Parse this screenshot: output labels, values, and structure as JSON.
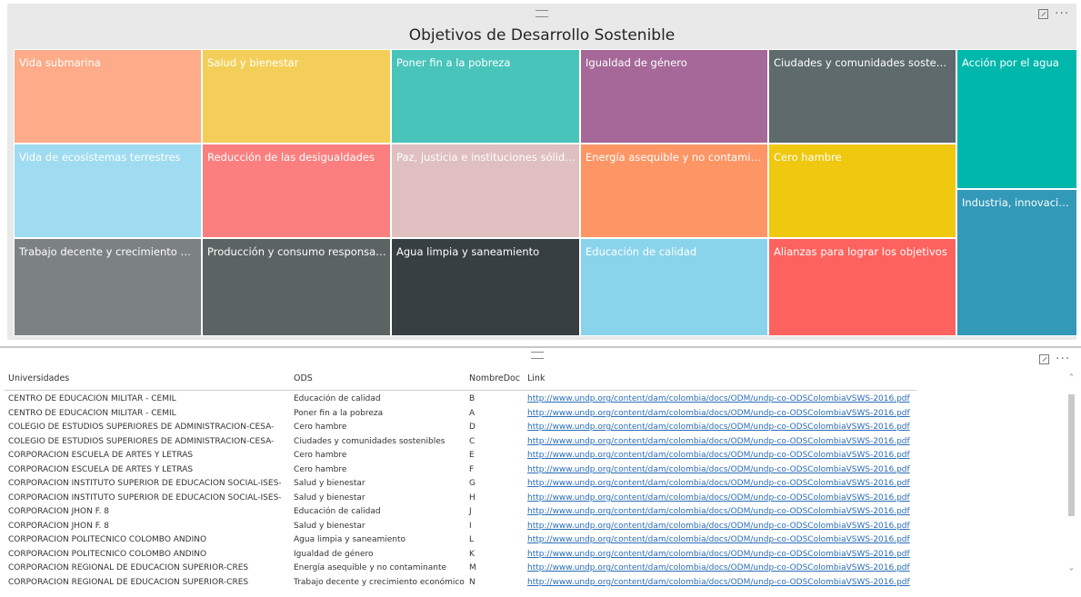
{
  "treemap": {
    "title": "Objetivos de Desarrollo Sostenible",
    "tiles": [
      {
        "label": "Vida submarina",
        "color": "#fdab89"
      },
      {
        "label": "Salud y bienestar",
        "color": "#f3cf5a"
      },
      {
        "label": "Poner fin a la pobreza",
        "color": "#48c4ba"
      },
      {
        "label": "Igualdad de género",
        "color": "#a56898"
      },
      {
        "label": "Ciudades y comunidades sostenibles",
        "color": "#5e6a6b"
      },
      {
        "label": "Acción por el agua",
        "color": "#00b7ac"
      },
      {
        "label": "Vida de ecosistemas terrestres",
        "color": "#9fdcf1"
      },
      {
        "label": "Reducción de las desigualdades",
        "color": "#fc7f7f"
      },
      {
        "label": "Paz, justicia e instituciones sólidas",
        "color": "#dfbfc0"
      },
      {
        "label": "Energía asequible y no contaminante",
        "color": "#fd9565"
      },
      {
        "label": "Cero hambre",
        "color": "#f0c80f"
      },
      {
        "label": "Industria, innovación e i...",
        "color": "#3299b8"
      },
      {
        "label": "Trabajo decente y crecimiento econó...",
        "color": "#7c8282"
      },
      {
        "label": "Producción y consumo responsable",
        "color": "#5b6363"
      },
      {
        "label": "Agua limpia y saneamiento",
        "color": "#373f43"
      },
      {
        "label": "Educación de calidad",
        "color": "#8ad4eb"
      },
      {
        "label": "Alianzas para lograr los objetivos",
        "color": "#fd625e"
      }
    ]
  },
  "table": {
    "headers": [
      "Universidades",
      "ODS",
      "NombreDoc",
      "Link"
    ],
    "rows": [
      [
        "CENTRO DE EDUCACION MILITAR - CEMIL",
        "Educación de calidad",
        "B",
        "http://www.undp.org/content/dam/colombia/docs/ODM/undp-co-ODSColombiaVSWS-2016.pdf"
      ],
      [
        "CENTRO DE EDUCACION MILITAR - CEMIL",
        "Poner fin a la pobreza",
        "A",
        "http://www.undp.org/content/dam/colombia/docs/ODM/undp-co-ODSColombiaVSWS-2016.pdf"
      ],
      [
        "COLEGIO DE ESTUDIOS SUPERIORES DE ADMINISTRACION-CESA-",
        "Cero hambre",
        "D",
        "http://www.undp.org/content/dam/colombia/docs/ODM/undp-co-ODSColombiaVSWS-2016.pdf"
      ],
      [
        "COLEGIO DE ESTUDIOS SUPERIORES DE ADMINISTRACION-CESA-",
        "Ciudades y comunidades sostenibles",
        "C",
        "http://www.undp.org/content/dam/colombia/docs/ODM/undp-co-ODSColombiaVSWS-2016.pdf"
      ],
      [
        "CORPORACION ESCUELA DE ARTES Y LETRAS",
        "Cero hambre",
        "E",
        "http://www.undp.org/content/dam/colombia/docs/ODM/undp-co-ODSColombiaVSWS-2016.pdf"
      ],
      [
        "CORPORACION ESCUELA DE ARTES Y LETRAS",
        "Cero hambre",
        "F",
        "http://www.undp.org/content/dam/colombia/docs/ODM/undp-co-ODSColombiaVSWS-2016.pdf"
      ],
      [
        "CORPORACION INSTITUTO SUPERIOR DE EDUCACION SOCIAL-ISES-",
        "Salud y bienestar",
        "G",
        "http://www.undp.org/content/dam/colombia/docs/ODM/undp-co-ODSColombiaVSWS-2016.pdf"
      ],
      [
        "CORPORACION INSTITUTO SUPERIOR DE EDUCACION SOCIAL-ISES-",
        "Salud y bienestar",
        "H",
        "http://www.undp.org/content/dam/colombia/docs/ODM/undp-co-ODSColombiaVSWS-2016.pdf"
      ],
      [
        "CORPORACION JHON F. 8",
        "Educación de calidad",
        "J",
        "http://www.undp.org/content/dam/colombia/docs/ODM/undp-co-ODSColombiaVSWS-2016.pdf"
      ],
      [
        "CORPORACION JHON F. 8",
        "Salud y bienestar",
        "I",
        "http://www.undp.org/content/dam/colombia/docs/ODM/undp-co-ODSColombiaVSWS-2016.pdf"
      ],
      [
        "CORPORACION POLITECNICO COLOMBO ANDINO",
        "Agua limpia y saneamiento",
        "L",
        "http://www.undp.org/content/dam/colombia/docs/ODM/undp-co-ODSColombiaVSWS-2016.pdf"
      ],
      [
        "CORPORACION POLITECNICO COLOMBO ANDINO",
        "Igualdad de género",
        "K",
        "http://www.undp.org/content/dam/colombia/docs/ODM/undp-co-ODSColombiaVSWS-2016.pdf"
      ],
      [
        "CORPORACION REGIONAL DE EDUCACION SUPERIOR-CRES",
        "Energía asequible y no contaminante",
        "M",
        "http://www.undp.org/content/dam/colombia/docs/ODM/undp-co-ODSColombiaVSWS-2016.pdf"
      ],
      [
        "CORPORACION REGIONAL DE EDUCACION SUPERIOR-CRES",
        "Trabajo decente y crecimiento económico",
        "N",
        "http://www.undp.org/content/dam/colombia/docs/ODM/undp-co-ODSColombiaVSWS-2016.pdf"
      ]
    ]
  },
  "icons": {
    "focus": "focus-mode-icon",
    "more": "more-options-icon",
    "grip": "drag-grip-icon",
    "scroll_up": "chevron-up-icon",
    "scroll_down": "chevron-down-icon",
    "more_glyph": "···",
    "up_glyph": "˄",
    "down_glyph": "˅"
  }
}
